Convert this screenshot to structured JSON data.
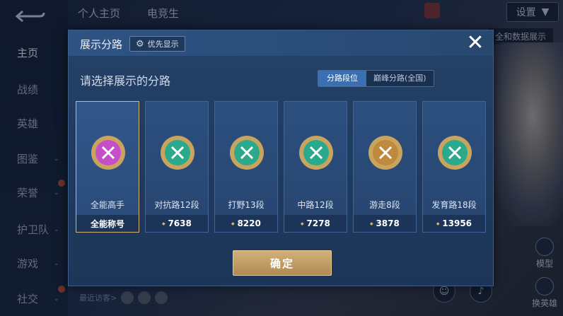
{
  "background": {
    "tabs": [
      "个人主页",
      "电竞生"
    ],
    "sidebar": [
      {
        "label": "主页",
        "active": true,
        "chevron": false,
        "dot": false
      },
      {
        "label": "战绩",
        "active": false,
        "chevron": false,
        "dot": false
      },
      {
        "label": "英雄",
        "active": false,
        "chevron": false,
        "dot": false
      },
      {
        "label": "图鉴",
        "active": false,
        "chevron": true,
        "dot": false
      },
      {
        "label": "荣誉",
        "active": false,
        "chevron": true,
        "dot": true
      },
      {
        "label": "护卫队",
        "active": false,
        "chevron": true,
        "dot": false
      },
      {
        "label": "游戏",
        "active": false,
        "chevron": true,
        "dot": false
      },
      {
        "label": "社交",
        "active": false,
        "chevron": true,
        "dot": true
      }
    ],
    "settings_label": "设置",
    "hint_text": "全和数据展示",
    "right_buttons": [
      "模型",
      "换英雄"
    ],
    "recent_visitors": "最近访客>"
  },
  "modal": {
    "title": "展示分路",
    "pref_button": "优先显示",
    "subtitle": "请选择展示的分路",
    "segments": [
      "分路段位",
      "巅峰分路(全国)"
    ],
    "confirm_label": "确定",
    "cards": [
      {
        "name": "全能高手",
        "value": "全能称号",
        "selected": true,
        "emblem": "all-round-emblem",
        "color": "#c54fc8",
        "show_gem": false
      },
      {
        "name": "对抗路12段",
        "value": "7638",
        "selected": false,
        "emblem": "clash-lane-emblem",
        "color": "#2aa98c",
        "show_gem": true
      },
      {
        "name": "打野13段",
        "value": "8220",
        "selected": false,
        "emblem": "jungle-emblem",
        "color": "#2aa98c",
        "show_gem": true
      },
      {
        "name": "中路12段",
        "value": "7278",
        "selected": false,
        "emblem": "mid-lane-emblem",
        "color": "#2aa98c",
        "show_gem": true
      },
      {
        "name": "游走8段",
        "value": "3878",
        "selected": false,
        "emblem": "roam-emblem",
        "color": "#c08a3e",
        "show_gem": true
      },
      {
        "name": "发育路18段",
        "value": "13956",
        "selected": false,
        "emblem": "farm-lane-emblem",
        "color": "#2aa98c",
        "show_gem": true
      }
    ]
  }
}
